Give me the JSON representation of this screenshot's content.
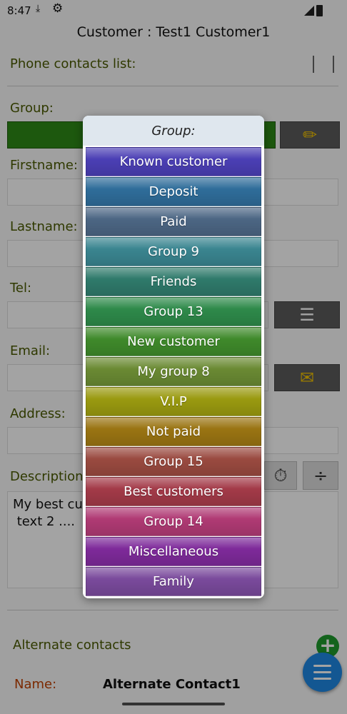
{
  "status_bar": {
    "time": "8:47"
  },
  "title": "Customer : Test1 Customer1",
  "form": {
    "phone_contacts_label": "Phone contacts list:",
    "group_label": "Group:",
    "firstname_label": "Firstname:",
    "lastname_label": "Lastname:",
    "tel_label": "Tel:",
    "email_label": "Email:",
    "address_label": "Address:",
    "description_label": "Description",
    "description_text": "My best cu\n text 2 ...."
  },
  "alternate": {
    "label": "Alternate contacts",
    "name_label": "Name:",
    "name_value": "Alternate Contact1"
  },
  "dialog": {
    "title": "Group:",
    "items": [
      {
        "label": "Known customer",
        "color": "#4b3fb5"
      },
      {
        "label": "Deposit",
        "color": "#2f6d9a"
      },
      {
        "label": "Paid",
        "color": "#4c6684"
      },
      {
        "label": "Group 9",
        "color": "#3a8590"
      },
      {
        "label": "Friends",
        "color": "#2f7a6b"
      },
      {
        "label": "Group 13",
        "color": "#2e8a4a"
      },
      {
        "label": "New customer",
        "color": "#3f8a2b"
      },
      {
        "label": "My group 8",
        "color": "#6a8a33"
      },
      {
        "label": "V.I.P",
        "color": "#9a9a10"
      },
      {
        "label": "Not paid",
        "color": "#9a7412"
      },
      {
        "label": "Group 15",
        "color": "#9a4a40"
      },
      {
        "label": "Best customers",
        "color": "#a33a48"
      },
      {
        "label": "Group 14",
        "color": "#b03a74"
      },
      {
        "label": "Miscellaneous",
        "color": "#7e2a9a"
      },
      {
        "label": "Family",
        "color": "#7a4a9c"
      }
    ]
  }
}
